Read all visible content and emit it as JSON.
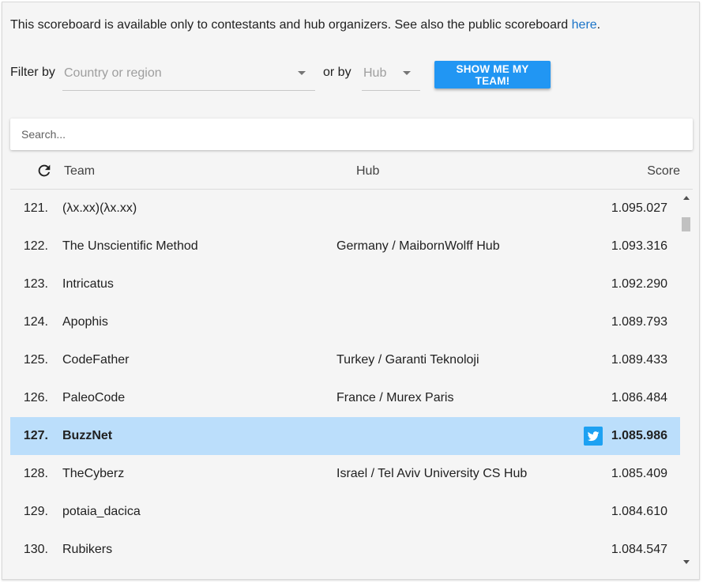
{
  "notice": {
    "text": "This scoreboard is available only to contestants and hub organizers. See also the public scoreboard ",
    "link_text": "here",
    "suffix": "."
  },
  "filters": {
    "filter_by_label": "Filter by",
    "country_placeholder": "Country or region",
    "or_by_label": "or by",
    "hub_placeholder": "Hub",
    "show_team_button": "SHOW ME MY TEAM!"
  },
  "search": {
    "placeholder": "Search..."
  },
  "table": {
    "refresh_icon": "refresh-icon",
    "headers": {
      "team": "Team",
      "hub": "Hub",
      "score": "Score"
    },
    "rows": [
      {
        "rank": "121.",
        "team": "(λx.xx)(λx.xx)",
        "hub": "",
        "score": "1.095.027"
      },
      {
        "rank": "122.",
        "team": "The Unscientific Method",
        "hub": "Germany / MaibornWolff Hub",
        "score": "1.093.316"
      },
      {
        "rank": "123.",
        "team": "Intricatus",
        "hub": "",
        "score": "1.092.290"
      },
      {
        "rank": "124.",
        "team": "Apophis",
        "hub": "",
        "score": "1.089.793"
      },
      {
        "rank": "125.",
        "team": "CodeFather",
        "hub": "Turkey / Garanti Teknoloji",
        "score": "1.089.433"
      },
      {
        "rank": "126.",
        "team": "PaleoCode",
        "hub": "France / Murex Paris",
        "score": "1.086.484"
      },
      {
        "rank": "127.",
        "team": "BuzzNet",
        "hub": "",
        "score": "1.085.986",
        "highlighted": true,
        "icon": "twitter-icon"
      },
      {
        "rank": "128.",
        "team": "TheCyberz",
        "hub": "Israel / Tel Aviv University CS Hub",
        "score": "1.085.409"
      },
      {
        "rank": "129.",
        "team": "potaia_dacica",
        "hub": "",
        "score": "1.084.610"
      },
      {
        "rank": "130.",
        "team": "Rubikers",
        "hub": "",
        "score": "1.084.547"
      }
    ]
  },
  "colors": {
    "accent": "#2196f3",
    "highlight_row": "#bbdefb",
    "link": "#1a73c8",
    "twitter": "#1da1f2"
  }
}
